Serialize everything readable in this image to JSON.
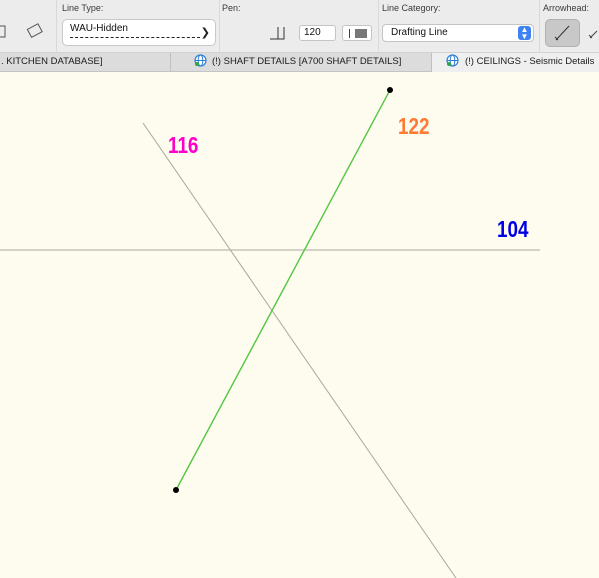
{
  "toolbar": {
    "line_type_label": "Line Type:",
    "line_type_value": "WAU-Hidden",
    "pen_label": "Pen:",
    "pen_value": "120",
    "line_category_label": "Line Category:",
    "line_category_value": "Drafting Line",
    "arrowhead_label": "Arrowhead:"
  },
  "tabs": [
    {
      "label": ". KITCHEN DATABASE]",
      "active": false
    },
    {
      "label": "(!) SHAFT DETAILS [A700 SHAFT DETAILS]",
      "active": false
    },
    {
      "label": "(!) CEILINGS - Seismic Details",
      "active": true
    }
  ],
  "canvas": {
    "labels": [
      {
        "text": "116",
        "color": "#ff00cc"
      },
      {
        "text": "122",
        "color": "#ff7a33"
      },
      {
        "text": "104",
        "color": "#0000e6"
      }
    ],
    "selected_line_color": "#55c544",
    "guide_line_color": "#a8a8a0"
  }
}
